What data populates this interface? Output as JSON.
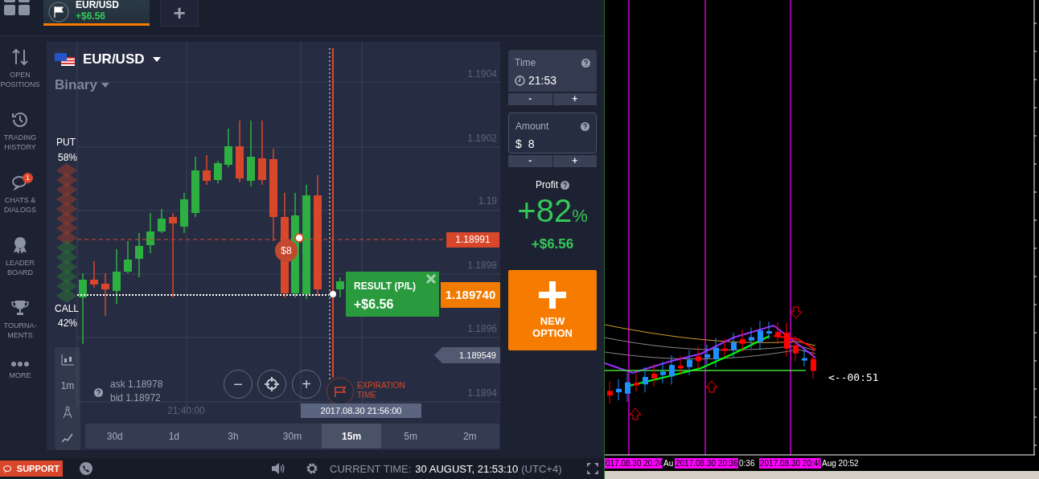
{
  "top_bar": {
    "asset_tabs": [
      {
        "name": "EUR/USD",
        "profit": "+$6.56",
        "selected": true
      }
    ],
    "add_tab": "+"
  },
  "sidebar": {
    "items": [
      {
        "kind": "positions",
        "lines": [
          "OPEN",
          "POSITIONS"
        ]
      },
      {
        "kind": "history",
        "lines": [
          "TRADING",
          "HISTORY"
        ]
      },
      {
        "kind": "chats",
        "lines": [
          "CHATS &",
          "DIALOGS"
        ],
        "badge": "1"
      },
      {
        "kind": "leaders",
        "lines": [
          "LEADER",
          "BOARD"
        ]
      },
      {
        "kind": "tournaments",
        "lines": [
          "TOURNA-",
          "MENTS"
        ]
      },
      {
        "kind": "more",
        "lines": [
          "MORE"
        ]
      }
    ]
  },
  "chart": {
    "asset": "EUR/USD",
    "instrument": "Binary",
    "put": {
      "label": "PUT",
      "percent": "58%"
    },
    "call": {
      "label": "CALL",
      "percent": "42%"
    },
    "price_labels": [
      "1.1904",
      "1.1902",
      "1.19",
      "1.1898",
      "1.1896",
      "1.1894"
    ],
    "strike_tag": "1.18991",
    "current_tag": "1.189740",
    "cursor_tag": "1.189549",
    "bet_marker": "$8",
    "result": {
      "title": "RESULT (P/L)",
      "value": "+$6.56"
    },
    "zoom_buttons": [
      "−",
      "+"
    ],
    "expiration": [
      "EXPIRATION",
      "TIME"
    ],
    "time_label": "21:40:00",
    "date_tooltip": "2017.08.30 21:56:00",
    "ask": "ask 1.18978",
    "bid": "bid 1.18972",
    "candle_period": "1m",
    "timeframes": [
      {
        "label": "30d",
        "selected": false
      },
      {
        "label": "1d",
        "selected": false
      },
      {
        "label": "3h",
        "selected": false
      },
      {
        "label": "30m",
        "selected": false
      },
      {
        "label": "15m",
        "selected": true
      },
      {
        "label": "5m",
        "selected": false
      },
      {
        "label": "2m",
        "selected": false
      }
    ]
  },
  "order_panel": {
    "time": {
      "label": "Time",
      "value": "21:53"
    },
    "amount": {
      "label": "Amount",
      "currency": "$",
      "value": "8"
    },
    "steppers": [
      "-",
      "+"
    ],
    "profit": {
      "label": "Profit",
      "percent": "+82",
      "percent_sign": "%",
      "amount": "+$6.56"
    },
    "new_option": [
      "NEW",
      "OPTION"
    ]
  },
  "status_bar": {
    "support": "SUPPORT",
    "current_time_label": "CURRENT TIME:",
    "current_time": "30 AUGUST, 21:53:10",
    "timezone": "(UTC+4)"
  },
  "mt4_chart": {
    "countdown": "<--00:51",
    "time_labels": [
      {
        "text": "017.08.30 20:24",
        "highlighted": true
      },
      {
        "text": "Au",
        "highlighted": false
      },
      {
        "text": "2017.08.30 20:36",
        "highlighted": true
      },
      {
        "text": "0:36",
        "highlighted": false
      },
      {
        "text": "2017.08.30 20:49",
        "highlighted": true
      },
      {
        "text": "Aug 20:52",
        "highlighted": false
      }
    ]
  }
}
